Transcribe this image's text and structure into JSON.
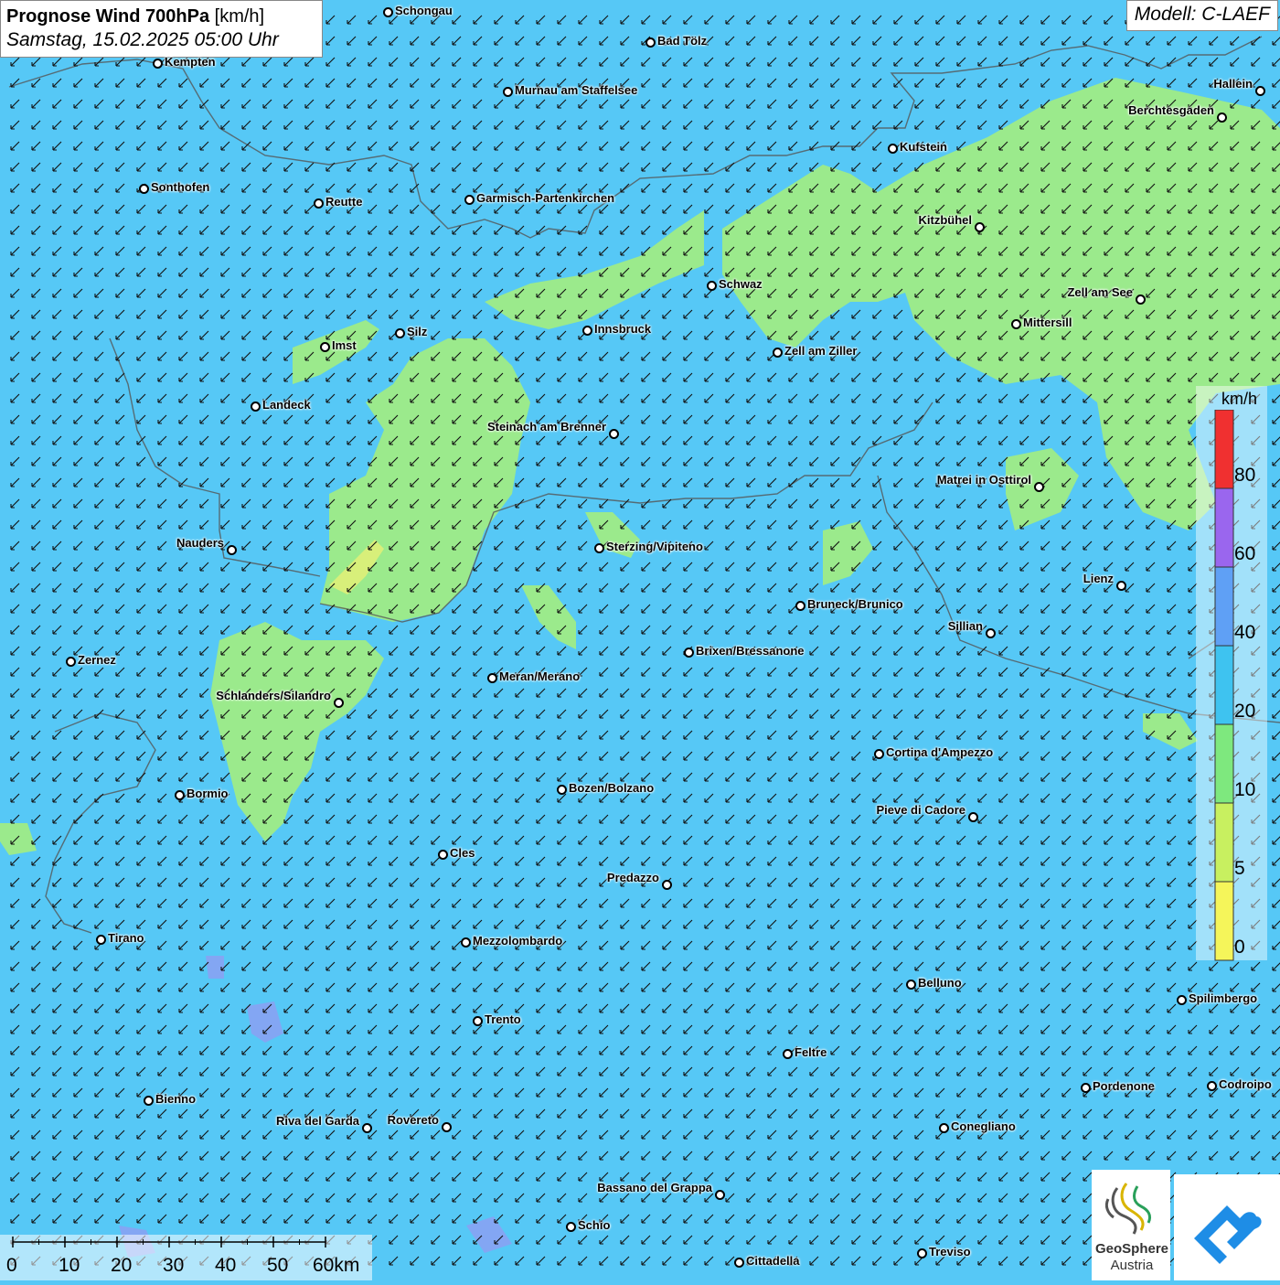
{
  "header": {
    "title_bold": "Prognose Wind 700hPa",
    "title_unit": "[km/h]",
    "datetime": "Samstag, 15.02.2025 05:00 Uhr",
    "model": "Modell: C-LAEF"
  },
  "legend": {
    "unit": "km/h",
    "labels": [
      "80",
      "60",
      "40",
      "20",
      "10",
      "5",
      "0"
    ],
    "colors": [
      "#f03030",
      "#9a66ee",
      "#5fa0f5",
      "#3ec3f0",
      "#7ee87e",
      "#c8f060",
      "#f5f55a"
    ]
  },
  "scale_bar": {
    "labels": [
      "0",
      "10",
      "20",
      "30",
      "40",
      "50",
      "60km"
    ]
  },
  "logos": {
    "geosphere_line1": "GeoSphere",
    "geosphere_line2": "Austria"
  },
  "colors": {
    "sea_blue": "#56c8f6",
    "light_green": "#9bea8c",
    "arrow": "#111111",
    "border": "#555555"
  },
  "cities": [
    {
      "name": "Schongau"
    },
    {
      "name": "Bad Tölz"
    },
    {
      "name": "Kempten"
    },
    {
      "name": "Murnau am Staffelsee"
    },
    {
      "name": "Hallein"
    },
    {
      "name": "Berchtesgaden"
    },
    {
      "name": "Kufstein"
    },
    {
      "name": "Sonthofen"
    },
    {
      "name": "Reutte"
    },
    {
      "name": "Garmisch-Partenkirchen"
    },
    {
      "name": "Kitzbühel"
    },
    {
      "name": "Schwaz"
    },
    {
      "name": "Zell am See"
    },
    {
      "name": "Mittersill"
    },
    {
      "name": "Innsbruck"
    },
    {
      "name": "Imst"
    },
    {
      "name": "Silz"
    },
    {
      "name": "Zell am Ziller"
    },
    {
      "name": "Landeck"
    },
    {
      "name": "Steinach am Brenner"
    },
    {
      "name": "Matrei in Osttirol"
    },
    {
      "name": "Nauders"
    },
    {
      "name": "Sterzing/Vipiteno"
    },
    {
      "name": "Lienz"
    },
    {
      "name": "Bruneck/Brunico"
    },
    {
      "name": "Sillian"
    },
    {
      "name": "Brixen/Bressanone"
    },
    {
      "name": "Zernez"
    },
    {
      "name": "Meran/Merano"
    },
    {
      "name": "Schlanders/Silandro"
    },
    {
      "name": "Cortina d'Ampezzo"
    },
    {
      "name": "Bozen/Bolzano"
    },
    {
      "name": "Bormio"
    },
    {
      "name": "Pieve di Cadore"
    },
    {
      "name": "Cles"
    },
    {
      "name": "Predazzo"
    },
    {
      "name": "Tirano"
    },
    {
      "name": "Mezzolombardo"
    },
    {
      "name": "Belluno"
    },
    {
      "name": "Spilimbergo"
    },
    {
      "name": "Trento"
    },
    {
      "name": "Feltre"
    },
    {
      "name": "Pordenone"
    },
    {
      "name": "Codroipo"
    },
    {
      "name": "Bienno"
    },
    {
      "name": "Riva del Garda"
    },
    {
      "name": "Rovereto"
    },
    {
      "name": "Conegliano"
    },
    {
      "name": "Bassano del Grappa"
    },
    {
      "name": "Schio"
    },
    {
      "name": "Treviso"
    },
    {
      "name": "Cittadella"
    }
  ]
}
